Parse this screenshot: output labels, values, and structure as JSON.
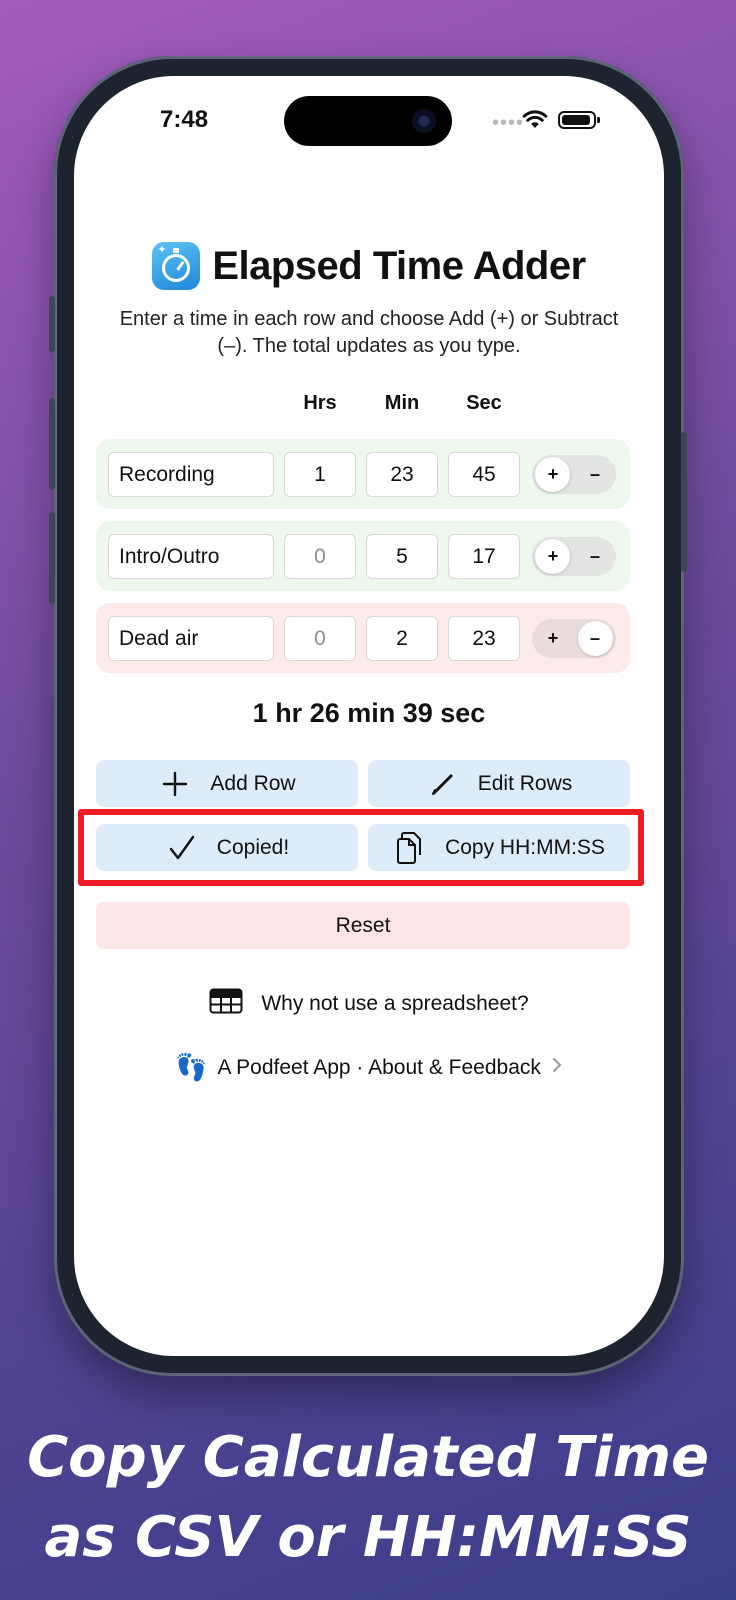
{
  "status_bar": {
    "time": "7:48",
    "signal_dots": "••••"
  },
  "app": {
    "title": "Elapsed Time Adder",
    "subtitle": "Enter a time in each row and choose Add (+) or Subtract (–). The total updates as you type.",
    "columns": {
      "hrs": "Hrs",
      "min": "Min",
      "sec": "Sec"
    },
    "rows": [
      {
        "label": "Recording",
        "hrs": "1",
        "min": "23",
        "sec": "45",
        "mode": "add"
      },
      {
        "label": "Intro/Outro",
        "hrs": "0",
        "min": "5",
        "sec": "17",
        "mode": "add"
      },
      {
        "label": "Dead air",
        "hrs": "0",
        "min": "2",
        "sec": "23",
        "mode": "subtract"
      }
    ],
    "toggle": {
      "plus": "+",
      "minus": "–"
    },
    "total": "1 hr 26 min 39 sec",
    "buttons": {
      "add_row": "Add Row",
      "edit_rows": "Edit Rows",
      "copied": "Copied!",
      "copy_hhmmss": "Copy HH:MM:SS",
      "reset": "Reset"
    },
    "links": {
      "spreadsheet": "Why not use a spreadsheet?",
      "about": "A Podfeet App · About & Feedback",
      "about_emoji": "👣"
    }
  },
  "caption": {
    "line1": "Copy Calculated Time",
    "line2": "as CSV or HH:MM:SS"
  },
  "colors": {
    "add_row_bg": "#eef8ef",
    "subtract_row_bg": "#fdeaea",
    "button_bg": "#dcecfb",
    "reset_bg": "#fde4e6",
    "highlight": "#ee1c25"
  }
}
